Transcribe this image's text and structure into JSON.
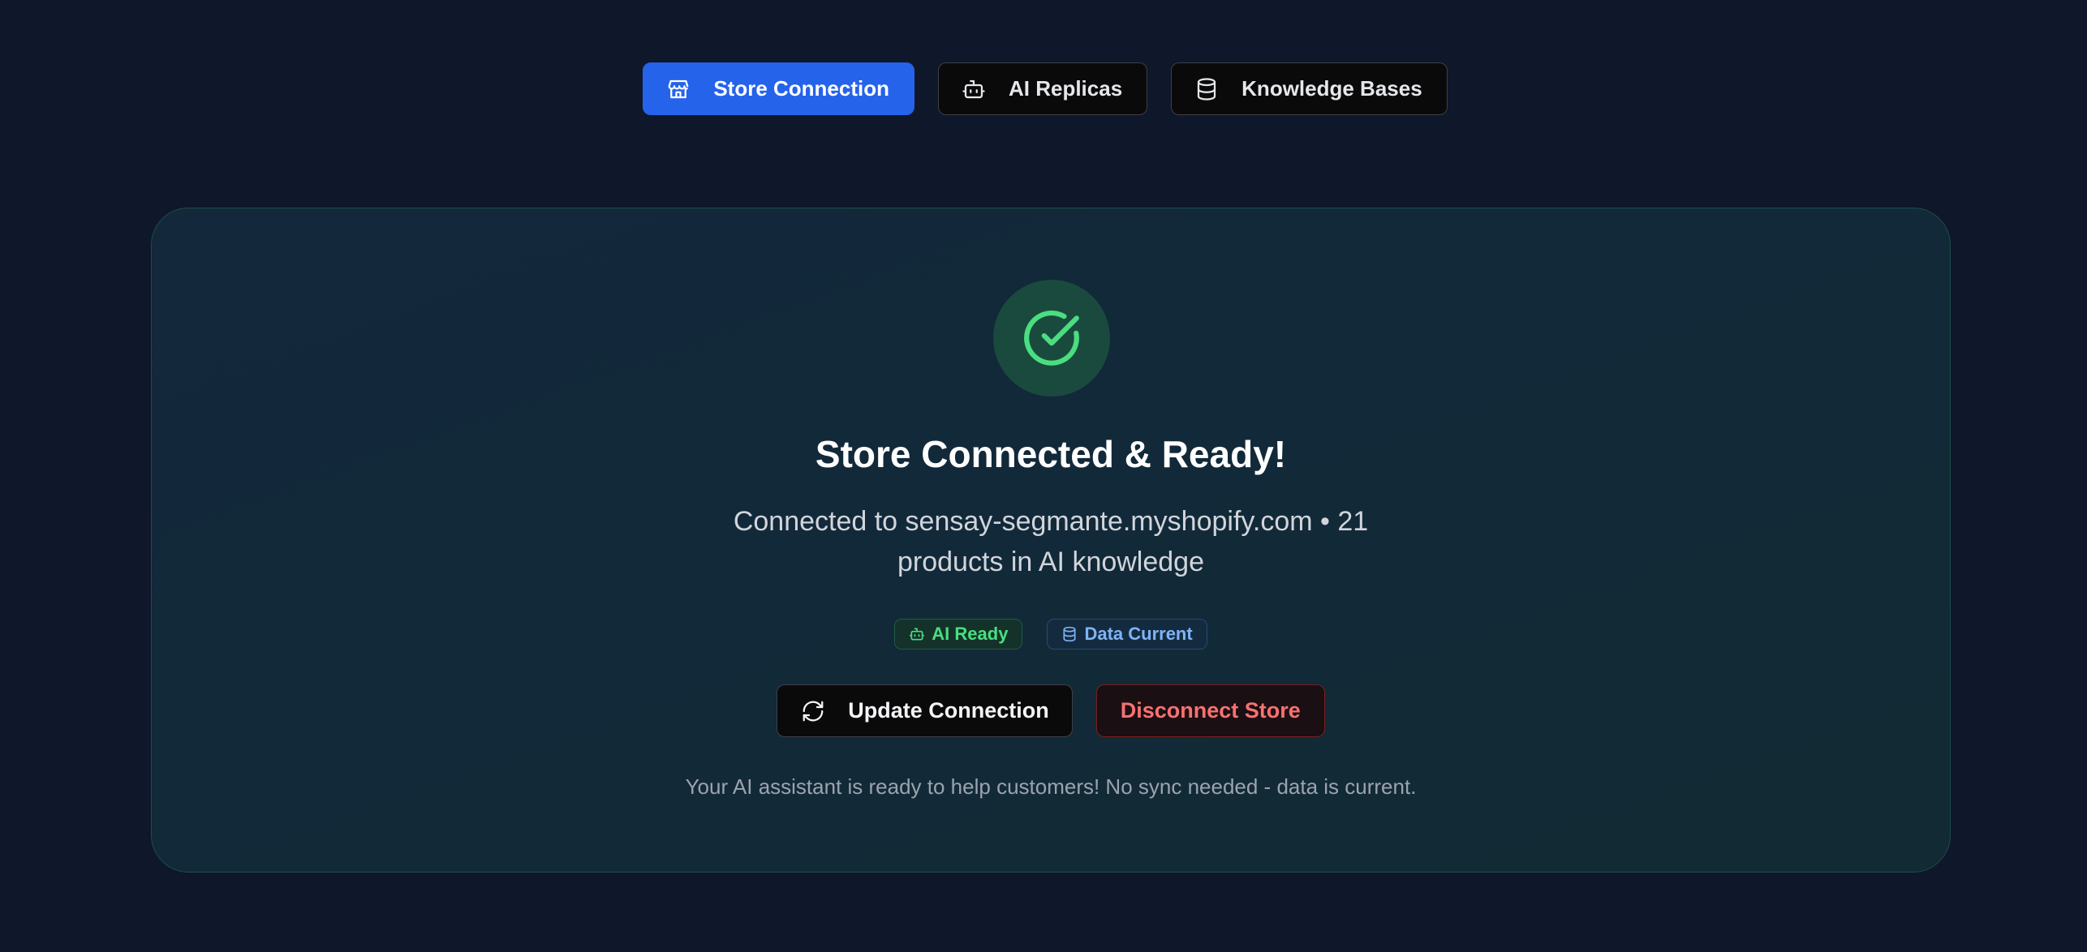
{
  "tabs": [
    {
      "label": "Store Connection",
      "icon": "store-icon",
      "active": true
    },
    {
      "label": "AI Replicas",
      "icon": "bot-icon",
      "active": false
    },
    {
      "label": "Knowledge Bases",
      "icon": "database-icon",
      "active": false
    }
  ],
  "status": {
    "icon": "check-circle-icon",
    "title": "Store Connected & Ready!",
    "subtitle": "Connected to sensay-segmante.myshopify.com • 21 products in AI knowledge",
    "badges": [
      {
        "label": "AI Ready",
        "icon": "bot-icon",
        "color": "#4ade80"
      },
      {
        "label": "Data Current",
        "icon": "database-icon",
        "color": "#7fb4f5"
      }
    ]
  },
  "actions": {
    "update_label": "Update Connection",
    "disconnect_label": "Disconnect Store"
  },
  "footnote": "Your AI assistant is ready to help customers! No sync needed - data is current.",
  "colors": {
    "background": "#0f172a",
    "accent": "#2563eb",
    "success": "#4ade80",
    "danger": "#f87171"
  }
}
